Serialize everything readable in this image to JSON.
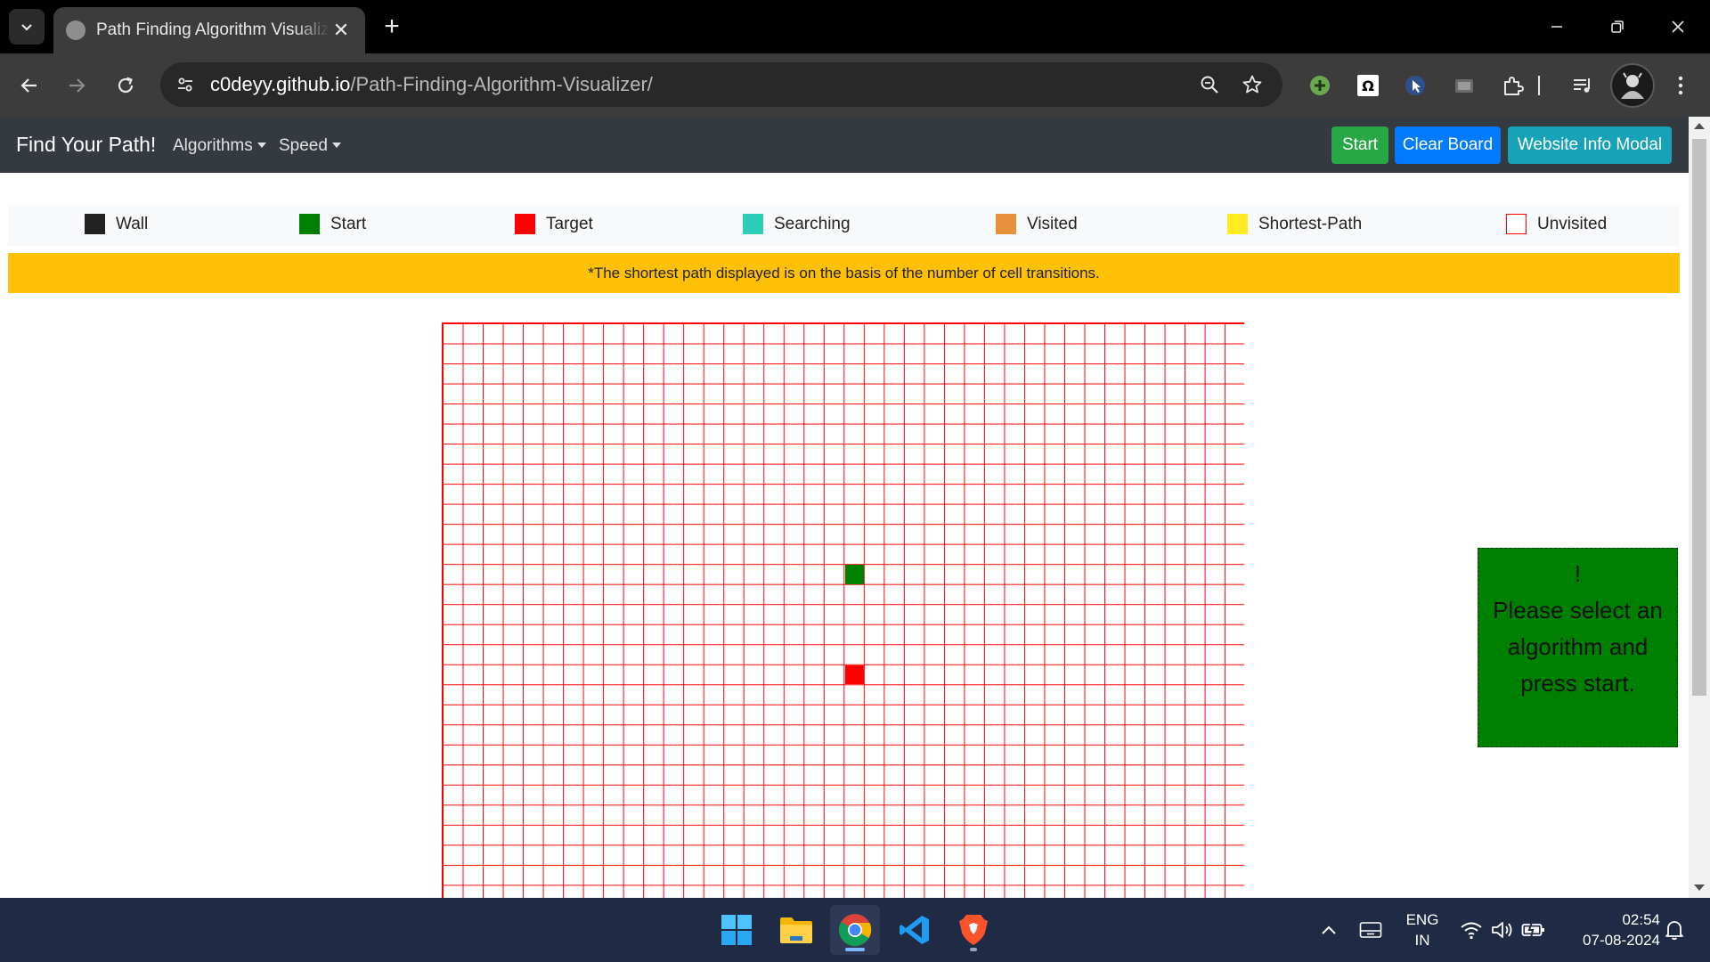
{
  "browser": {
    "tab_title": "Path Finding Algorithm Visualizer",
    "url_host": "c0deyy.github.io",
    "url_path": "/Path-Finding-Algorithm-Visualizer/"
  },
  "navbar": {
    "brand": "Find Your Path!",
    "algorithms_label": "Algorithms",
    "speed_label": "Speed",
    "start_label": "Start",
    "clear_label": "Clear Board",
    "info_label": "Website Info Modal"
  },
  "legend": [
    {
      "label": "Wall",
      "color": "#212121"
    },
    {
      "label": "Start",
      "color": "#008000"
    },
    {
      "label": "Target",
      "color": "#ff0000"
    },
    {
      "label": "Searching",
      "color": "#2bcfb7"
    },
    {
      "label": "Visited",
      "color": "#e8913c"
    },
    {
      "label": "Shortest-Path",
      "color": "#ffeb1f"
    },
    {
      "label": "Unvisited",
      "color": "#ffffff"
    }
  ],
  "notice": "*The shortest path displayed is on the basis of the number of cell transitions.",
  "grid": {
    "columns": 40,
    "cell_color_border": "#ff0000",
    "start_cell": {
      "row": 12,
      "col": 20
    },
    "target_cell": {
      "row": 17,
      "col": 20
    }
  },
  "message": {
    "mark": "!",
    "text": "Please select an algorithm and press start."
  },
  "taskbar": {
    "language_top": "ENG",
    "language_bottom": "IN",
    "time": "02:54",
    "date": "07-08-2024"
  }
}
